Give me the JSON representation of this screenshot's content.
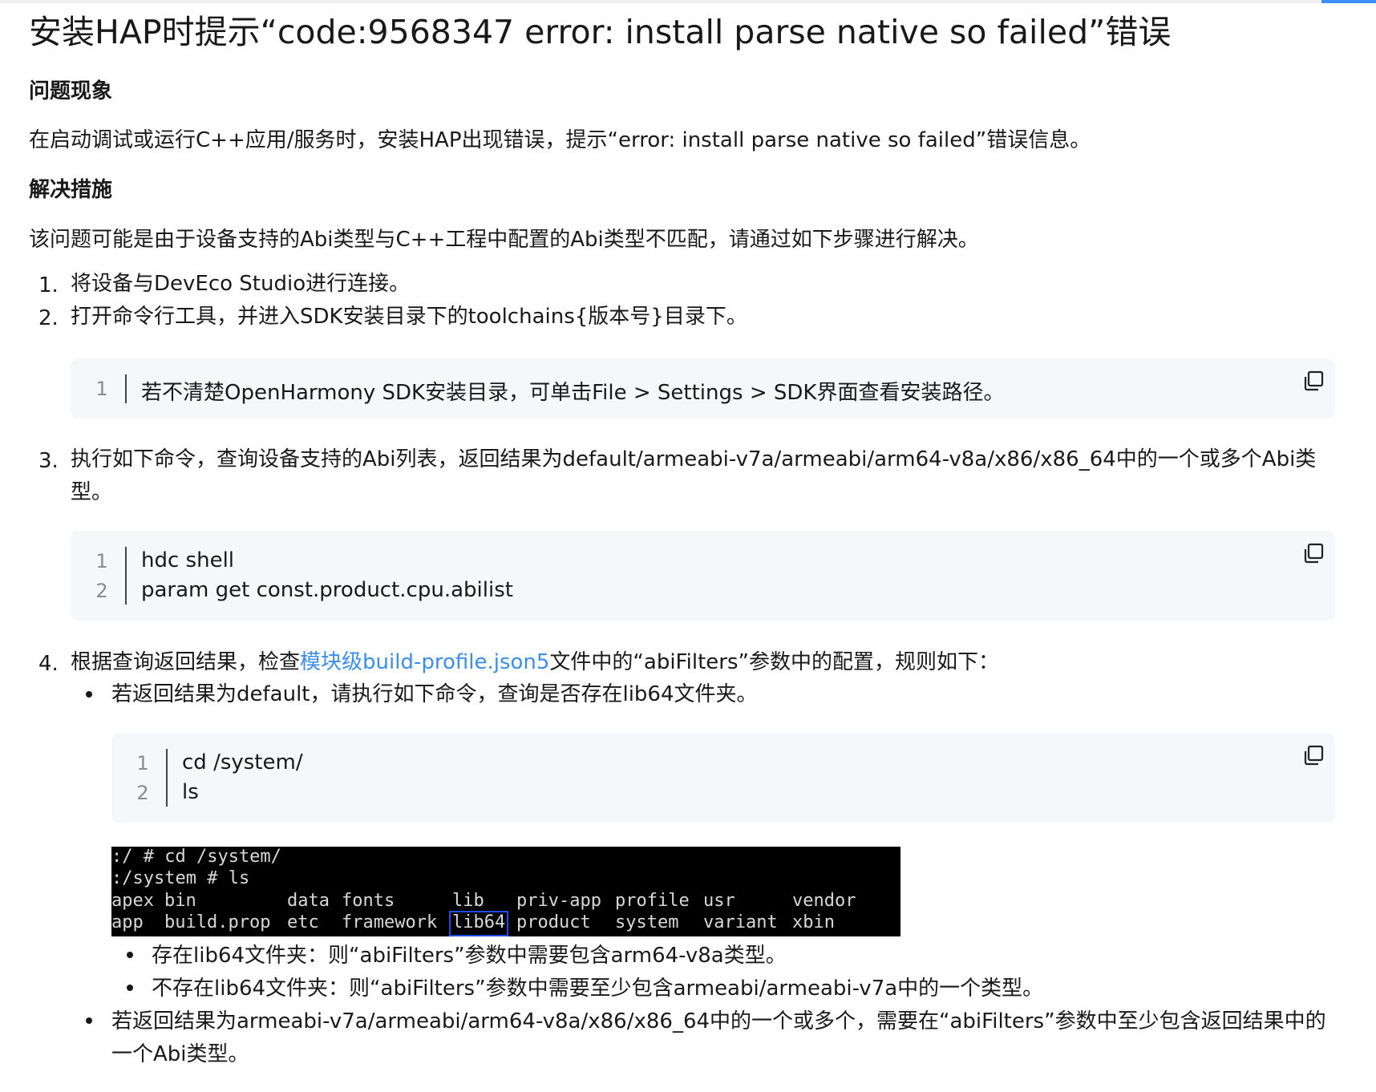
{
  "title": "安装HAP时提示“code:9568347 error: install parse native so failed”错误",
  "section_problem": {
    "heading": "问题现象",
    "text": "在启动调试或运行C++应用/服务时，安装HAP出现错误，提示“error: install parse native so failed”错误信息。"
  },
  "section_solution": {
    "heading": "解决措施",
    "intro": "该问题可能是由于设备支持的Abi类型与C++工程中配置的Abi类型不匹配，请通过如下步骤进行解决。"
  },
  "steps": [
    {
      "num": "1.",
      "text": "将设备与DevEco Studio进行连接。"
    },
    {
      "num": "2.",
      "text": "打开命令行工具，并进入SDK安装目录下的toolchains{版本号}目录下。"
    },
    {
      "num": "3.",
      "text_line1": "执行如下命令，查询设备支持的Abi列表，返回结果为default/armeabi-v7a/armeabi/arm64-v8a/x86/x86_64中的一个或多个Abi类",
      "text_line2": "型。"
    },
    {
      "num": "4.",
      "text_before": "根据查询返回结果，检查",
      "link": "模块级build-profile.json5",
      "text_after": "文件中的“abiFilters”参数中的配置，规则如下："
    }
  ],
  "code_block_1": {
    "lines": [
      {
        "n": "1",
        "code": "若不清楚OpenHarmony SDK安装目录，可单击File > Settings > SDK界面查看安装路径。"
      }
    ]
  },
  "code_block_2": {
    "lines": [
      {
        "n": "1",
        "code": "hdc shell"
      },
      {
        "n": "2",
        "code": "param get const.product.cpu.abilist"
      }
    ]
  },
  "code_block_3": {
    "lines": [
      {
        "n": "1",
        "code": "cd /system/"
      },
      {
        "n": "2",
        "code": "ls"
      }
    ]
  },
  "bullet_default": "若返回结果为default，请执行如下命令，查询是否存在lib64文件夹。",
  "terminal": {
    "line1": ":/ # cd /system/",
    "line2": ":/system # ls",
    "row3": [
      "apex",
      "bin",
      "data",
      "fonts",
      "lib",
      "priv-app",
      "profile",
      "usr",
      "vendor"
    ],
    "row4": [
      "app",
      "build.prop",
      "etc",
      "framework",
      "lib64",
      "product",
      "system",
      "variant",
      "xbin"
    ],
    "highlighted": "lib64"
  },
  "sub_bullets": [
    "存在lib64文件夹：则“abiFilters”参数中需要包含arm64-v8a类型。",
    "不存在lib64文件夹：则“abiFilters”参数中需要至少包含armeabi/armeabi-v7a中的一个类型。"
  ],
  "bullet_other_line1": "若返回结果为armeabi-v7a/armeabi/arm64-v8a/x86/x86_64中的一个或多个，需要在“abiFilters”参数中至少包含返回结果中的",
  "bullet_other_line2": "一个Abi类型。",
  "colors": {
    "link": "#3a8ef0",
    "code_bg": "#f6f7f8",
    "terminal_bg": "#000000",
    "highlight_box": "#1d4de8",
    "accent": "#3d8ef7"
  },
  "icons": {
    "copy": "copy-icon"
  }
}
